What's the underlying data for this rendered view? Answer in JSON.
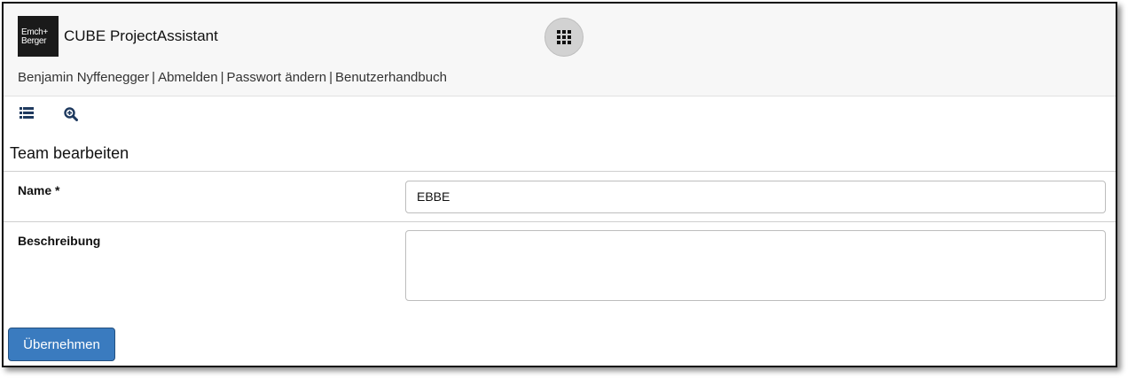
{
  "header": {
    "logo_line1": "Emch+",
    "logo_line2": "Berger",
    "app_title": "CUBE ProjectAssistant",
    "apps_icon": "grid-icon"
  },
  "userbar": {
    "user_name": "Benjamin Nyffenegger",
    "logout": "Abmelden",
    "change_password": "Passwort ändern",
    "manual": "Benutzerhandbuch",
    "separator": "|"
  },
  "toolbar": {
    "list_icon": "list-icon",
    "search_icon": "zoom-search-icon"
  },
  "form": {
    "title": "Team bearbeiten",
    "name_label": "Name *",
    "name_value": "EBBE",
    "description_label": "Beschreibung",
    "description_value": "",
    "submit_label": "Übernehmen"
  },
  "colors": {
    "primary_button": "#3a7bbf",
    "header_bg": "#f7f7f7",
    "icon_navy": "#1f3a5f"
  }
}
